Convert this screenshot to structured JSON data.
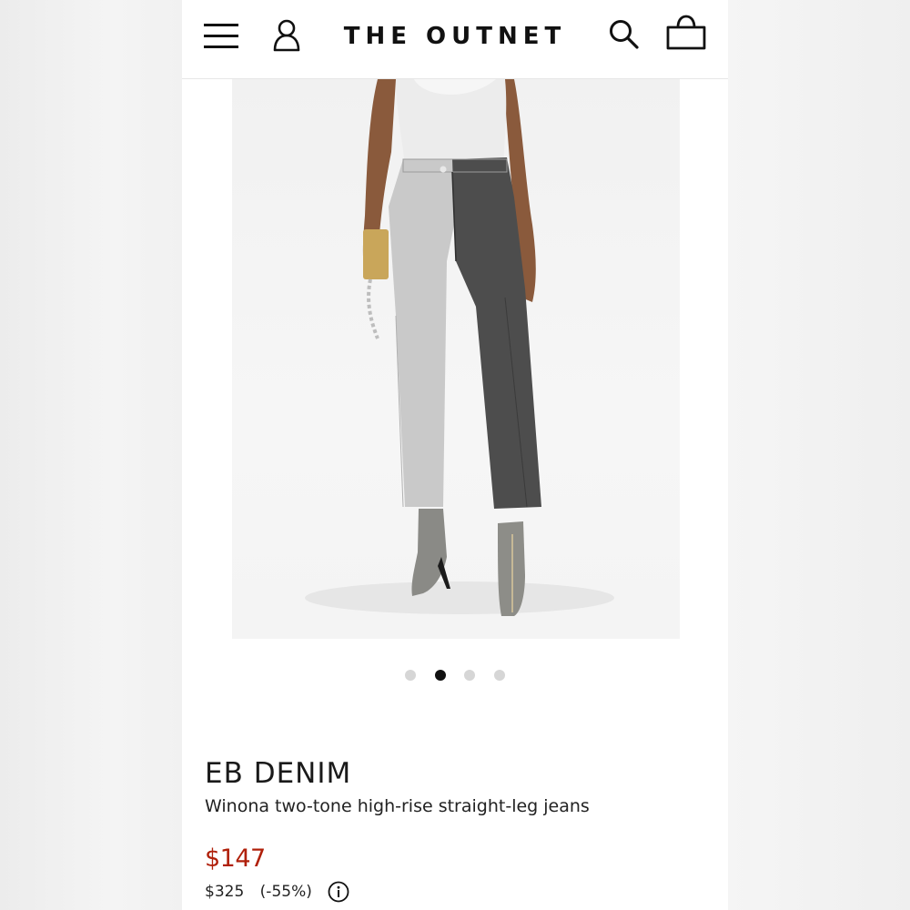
{
  "header": {
    "logo_text": "THE OUTNET",
    "icons": [
      "menu-icon",
      "account-icon",
      "search-icon",
      "shopping-bag-icon"
    ]
  },
  "gallery": {
    "image_count": 4,
    "active_index": 1
  },
  "product": {
    "brand": "EB DENIM",
    "name": "Winona two-tone high-rise straight-leg jeans",
    "sale_price": "$147",
    "original_price": "$325",
    "discount": "(-55%)",
    "sale_price_color": "#b0200a"
  }
}
